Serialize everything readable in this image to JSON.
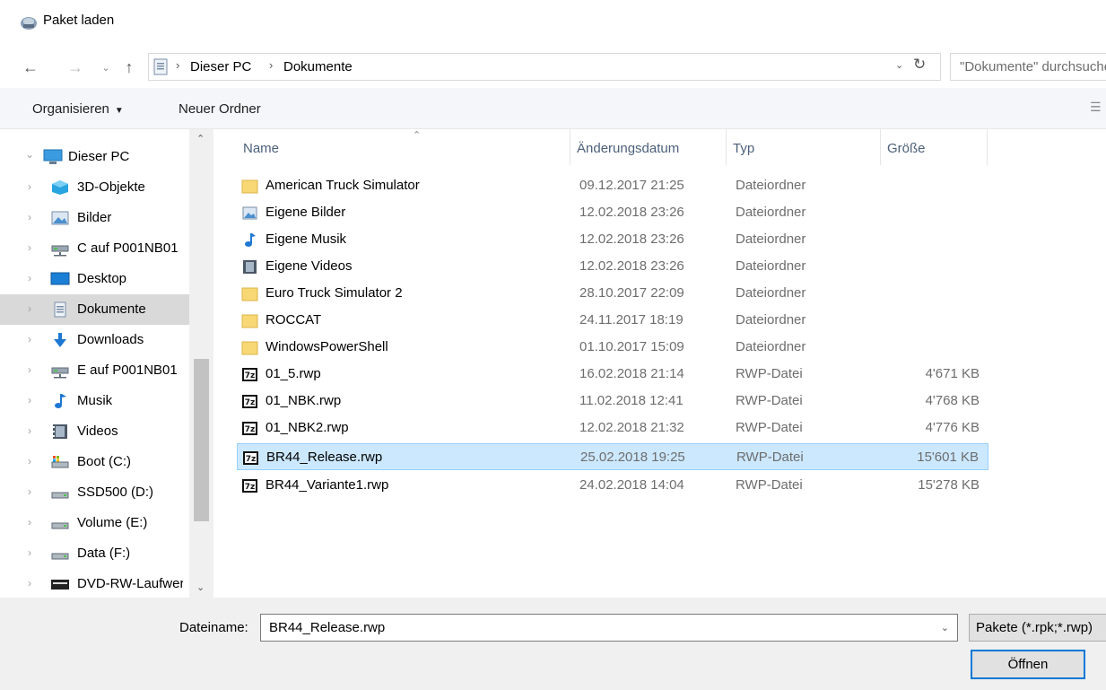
{
  "window": {
    "title": "Paket laden"
  },
  "address": {
    "crumbs": [
      "Dieser PC",
      "Dokumente"
    ],
    "sep": "›",
    "search_placeholder": "\"Dokumente\" durchsuchen"
  },
  "toolbar": {
    "organize": "Organisieren",
    "new_folder": "Neuer Ordner"
  },
  "nav": {
    "items": [
      {
        "label": "Dieser PC",
        "icon": "pc-icon"
      },
      {
        "label": "3D-Objekte",
        "icon": "3d-objects-icon"
      },
      {
        "label": "Bilder",
        "icon": "pictures-icon"
      },
      {
        "label": "C auf P001NB01",
        "icon": "network-drive-icon"
      },
      {
        "label": "Desktop",
        "icon": "desktop-icon"
      },
      {
        "label": "Dokumente",
        "icon": "documents-icon"
      },
      {
        "label": "Downloads",
        "icon": "downloads-icon"
      },
      {
        "label": "E auf P001NB01",
        "icon": "network-drive-icon"
      },
      {
        "label": "Musik",
        "icon": "music-icon"
      },
      {
        "label": "Videos",
        "icon": "videos-icon"
      },
      {
        "label": "Boot (C:)",
        "icon": "system-drive-icon"
      },
      {
        "label": "SSD500 (D:)",
        "icon": "drive-icon"
      },
      {
        "label": "Volume (E:)",
        "icon": "drive-icon"
      },
      {
        "label": "Data (F:)",
        "icon": "drive-icon"
      },
      {
        "label": "DVD-RW-Laufwerk",
        "icon": "dvd-drive-icon"
      }
    ]
  },
  "columns": {
    "name": "Name",
    "date": "Änderungsdatum",
    "type": "Typ",
    "size": "Größe"
  },
  "files": [
    {
      "name": "American Truck Simulator",
      "date": "09.12.2017 21:25",
      "type": "Dateiordner",
      "size": "",
      "icon": "folder-icon"
    },
    {
      "name": "Eigene Bilder",
      "date": "12.02.2018 23:26",
      "type": "Dateiordner",
      "size": "",
      "icon": "pictures-shortcut-icon"
    },
    {
      "name": "Eigene Musik",
      "date": "12.02.2018 23:26",
      "type": "Dateiordner",
      "size": "",
      "icon": "music-shortcut-icon"
    },
    {
      "name": "Eigene Videos",
      "date": "12.02.2018 23:26",
      "type": "Dateiordner",
      "size": "",
      "icon": "videos-shortcut-icon"
    },
    {
      "name": "Euro Truck Simulator 2",
      "date": "28.10.2017 22:09",
      "type": "Dateiordner",
      "size": "",
      "icon": "folder-icon"
    },
    {
      "name": "ROCCAT",
      "date": "24.11.2017 18:19",
      "type": "Dateiordner",
      "size": "",
      "icon": "folder-icon"
    },
    {
      "name": "WindowsPowerShell",
      "date": "01.10.2017 15:09",
      "type": "Dateiordner",
      "size": "",
      "icon": "folder-icon"
    },
    {
      "name": "01_5.rwp",
      "date": "16.02.2018 21:14",
      "type": "RWP-Datei",
      "size": "4'671 KB",
      "icon": "7z-file-icon"
    },
    {
      "name": "01_NBK.rwp",
      "date": "11.02.2018 12:41",
      "type": "RWP-Datei",
      "size": "4'768 KB",
      "icon": "7z-file-icon"
    },
    {
      "name": "01_NBK2.rwp",
      "date": "12.02.2018 21:32",
      "type": "RWP-Datei",
      "size": "4'776 KB",
      "icon": "7z-file-icon"
    },
    {
      "name": "BR44_Release.rwp",
      "date": "25.02.2018 19:25",
      "type": "RWP-Datei",
      "size": "15'601 KB",
      "icon": "7z-file-icon"
    },
    {
      "name": "BR44_Variante1.rwp",
      "date": "24.02.2018 14:04",
      "type": "RWP-Datei",
      "size": "15'278 KB",
      "icon": "7z-file-icon"
    }
  ],
  "bottom": {
    "filename_label": "Dateiname:",
    "filename_value": "BR44_Release.rwp",
    "filter": "Pakete (*.rpk;*.rwp)",
    "open_button": "Öffnen"
  }
}
